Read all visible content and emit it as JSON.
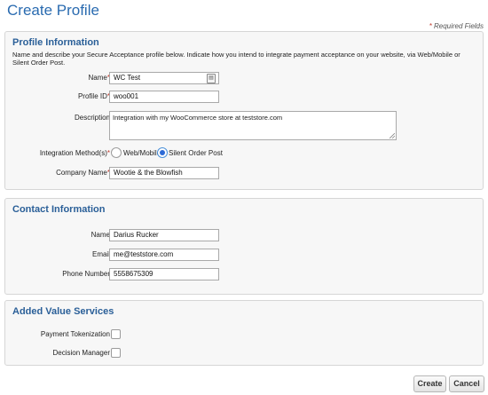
{
  "page_title": "Create Profile",
  "required_note": "Required Fields",
  "required_marker": "*",
  "profile_info": {
    "title": "Profile Information",
    "description": "Name and describe your Secure Acceptance profile below. Indicate how you intend to integrate payment acceptance on your website, via Web/Mobile or Silent Order Post.",
    "name_label": "Name",
    "name_value": "WC Test",
    "profile_id_label": "Profile ID",
    "profile_id_value": "woo001",
    "description_label": "Description",
    "description_value": "Integration with my WooCommerce store at teststore.com",
    "integration_label": "Integration Method(s)",
    "option_web_mobile": "Web/Mobile",
    "option_silent_order_post": "Silent Order Post",
    "selected_method": "Silent Order Post",
    "company_label": "Company Name",
    "company_value": "Wootie & the Blowfish"
  },
  "contact_info": {
    "title": "Contact Information",
    "name_label": "Name",
    "name_value": "Darius Rucker",
    "email_label": "Email",
    "email_value": "me@teststore.com",
    "phone_label": "Phone Number",
    "phone_value": "5558675309"
  },
  "added_value": {
    "title": "Added Value Services",
    "tokenization_label": "Payment Tokenization",
    "tokenization_checked": false,
    "decision_label": "Decision Manager",
    "decision_checked": false
  },
  "buttons": {
    "create": "Create",
    "cancel": "Cancel"
  }
}
